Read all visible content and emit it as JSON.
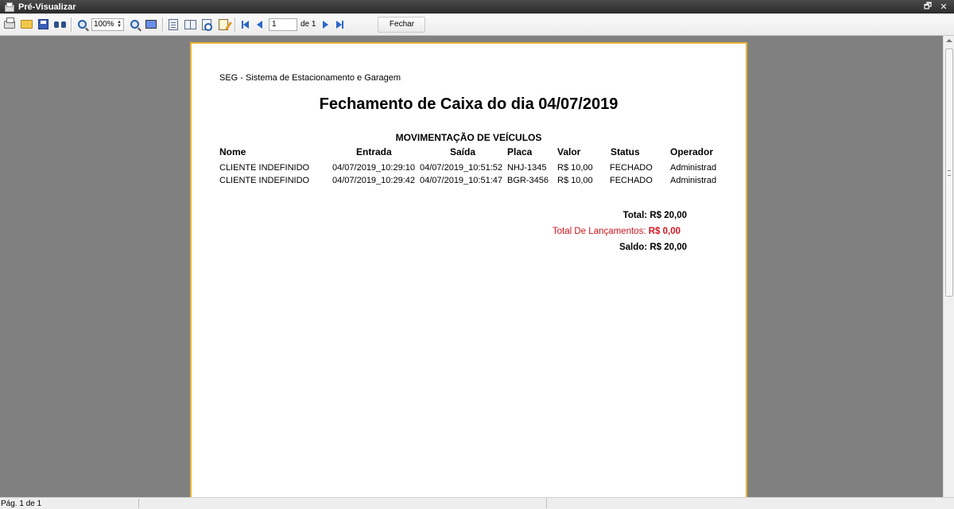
{
  "window": {
    "title": "Pré-Visualizar",
    "minimize_label": "_",
    "restore_label": "🗗",
    "close_label": "✕"
  },
  "toolbar": {
    "zoom_value": "100%",
    "page_value": "1",
    "page_of": "de 1",
    "close_label": "Fechar",
    "icons": [
      "print-icon",
      "open-icon",
      "save-icon",
      "find-icon",
      "zoom-in-icon",
      "zoom-out-icon",
      "full-screen-icon",
      "single-page-icon",
      "two-pages-icon",
      "page-setup-icon",
      "edit-page-icon",
      "first-page-icon",
      "previous-page-icon",
      "next-page-icon",
      "last-page-icon"
    ]
  },
  "report": {
    "company": "SEG - Sistema de Estacionamento e Garagem",
    "title": "Fechamento de Caixa do dia 04/07/2019",
    "section": "MOVIMENTAÇÃO DE VEÍCULOS",
    "columns": [
      "Nome",
      "Entrada",
      "Saída",
      "Placa",
      "Valor",
      "Status",
      "Operador"
    ],
    "rows": [
      [
        "CLIENTE INDEFINIDO",
        "04/07/2019_10:29:10",
        "04/07/2019_10:51:52",
        "NHJ-1345",
        "R$ 10,00",
        "FECHADO",
        "Administrad"
      ],
      [
        "CLIENTE INDEFINIDO",
        "04/07/2019_10:29:42",
        "04/07/2019_10:51:47",
        "BGR-3456",
        "R$ 10,00",
        "FECHADO",
        "Administrad"
      ]
    ],
    "total_label": "Total:",
    "total_value": "R$ 20,00",
    "launches_label": "Total De Lançamentos:",
    "launches_value": "R$ 0,00",
    "balance_label": "Saldo:",
    "balance_value": "R$ 20,00",
    "accent_color": "#d0161e",
    "page_border_color": "#e8b33a"
  },
  "status_bar": {
    "page_text": "Pág. 1 de 1"
  }
}
